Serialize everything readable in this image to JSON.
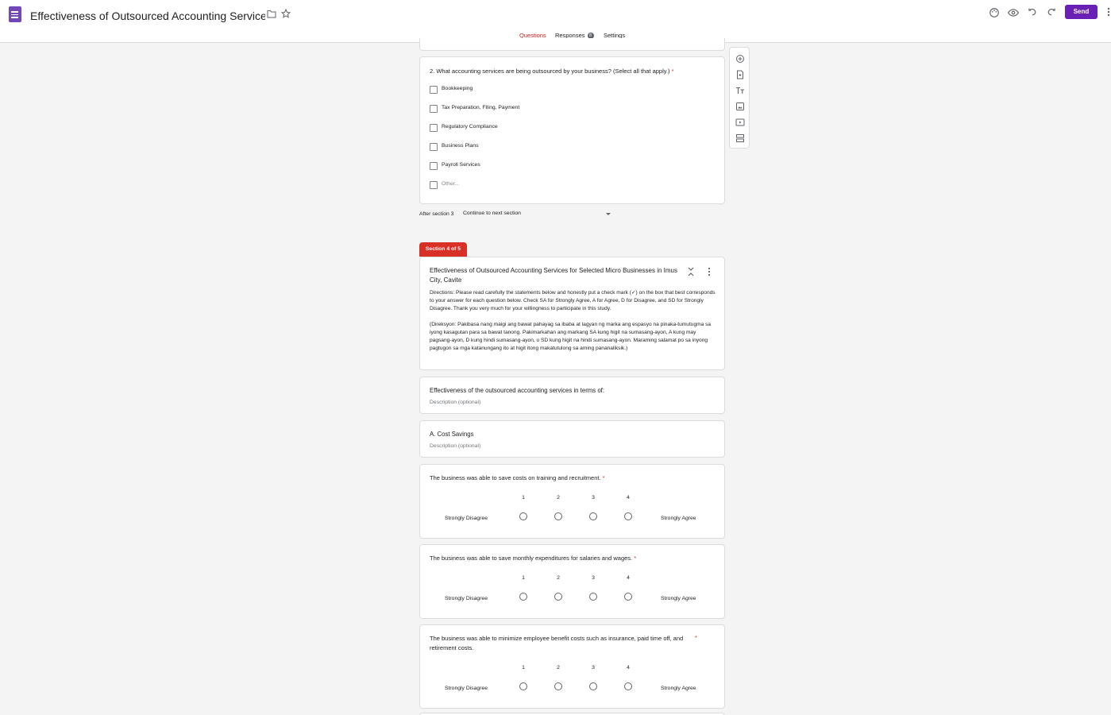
{
  "header": {
    "title": "Effectiveness of Outsourced Accounting Services for Selected Micro Busi",
    "send_label": "Send",
    "icons": [
      "forms-logo-icon",
      "folder-icon",
      "star-icon",
      "palette-icon",
      "preview-eye-icon",
      "undo-icon",
      "redo-icon",
      "more-vert-icon"
    ]
  },
  "tabs": {
    "questions": "Questions",
    "responses": "Responses",
    "responses_count": "8",
    "settings": "Settings"
  },
  "question2": {
    "title": "2. What accounting services are being outsourced by your business? (Select all that apply.)",
    "required_mark": "*",
    "options": [
      "Bookkeeping",
      "Tax Preparation, Filing, Payment",
      "Regulatory Compliance",
      "Business Plans",
      "Payroll Services",
      "Other..."
    ]
  },
  "after_section": {
    "label": "After section 3",
    "value": "Continue to next section"
  },
  "section4": {
    "tag": "Section 4 of 5",
    "title": "Effectiveness of Outsourced Accounting Services for Selected Micro Businesses in Imus City, Cavite",
    "directions_en": "Directions: Please read carefully the statements below and honestly put a check mark (✓) on the box that best corresponds to your answer for each question below. Check SA for Strongly Agree, A for Agree, D for Disagree, and SD for Strongly Disagree. Thank you very much for your willingness to participate in this study.",
    "directions_fil": "(Direksyon: Pakibasa nang maigi ang bawat pahayag sa ibaba at lagyan ng marka ang espasyo na pinaka-tumutugma sa iyong kasagutan para sa bawat tanong. Pakimarkahan ang markang SA kung higit na sumasang-ayon, A kung may pagsang-ayon, D kung hindi sumasang-ayon, o SD kung higit na hindi sumasang-ayon. Maraming salamat po sa inyong pagtugon sa mga katanungang ito at higit itong makatutulong sa aming pananaliksik.)"
  },
  "title_block1": {
    "title": "Effectiveness of the outsourced accounting services in terms of:",
    "description_placeholder": "Description (optional)"
  },
  "title_block2": {
    "title": "A. Cost Savings",
    "description_placeholder": "Description (optional)"
  },
  "scale_questions": [
    {
      "title": "The business was able to save costs on training and recruitment.",
      "required_mark": "*",
      "scale": [
        "1",
        "2",
        "3",
        "4"
      ],
      "low_label": "Strongly Disagree",
      "high_label": "Strongly Agree"
    },
    {
      "title": "The business was able to save monthly expenditures for salaries and wages.",
      "required_mark": "*",
      "scale": [
        "1",
        "2",
        "3",
        "4"
      ],
      "low_label": "Strongly Disagree",
      "high_label": "Strongly Agree"
    },
    {
      "title": "The business was able to minimize employee benefit costs such as insurance, paid time off, and retirement costs.",
      "required_mark": "*",
      "scale": [
        "1",
        "2",
        "3",
        "4"
      ],
      "low_label": "Strongly Disagree",
      "high_label": "Strongly Agree"
    }
  ],
  "toolbar_icons": [
    "add-question-icon",
    "import-questions-icon",
    "add-title-icon",
    "add-image-icon",
    "add-video-icon",
    "add-section-icon"
  ],
  "colors": {
    "accent": "#6a1fb5",
    "section_tag": "#d93025",
    "active_tab": "#c5221f",
    "background": "#f4f4f4"
  }
}
